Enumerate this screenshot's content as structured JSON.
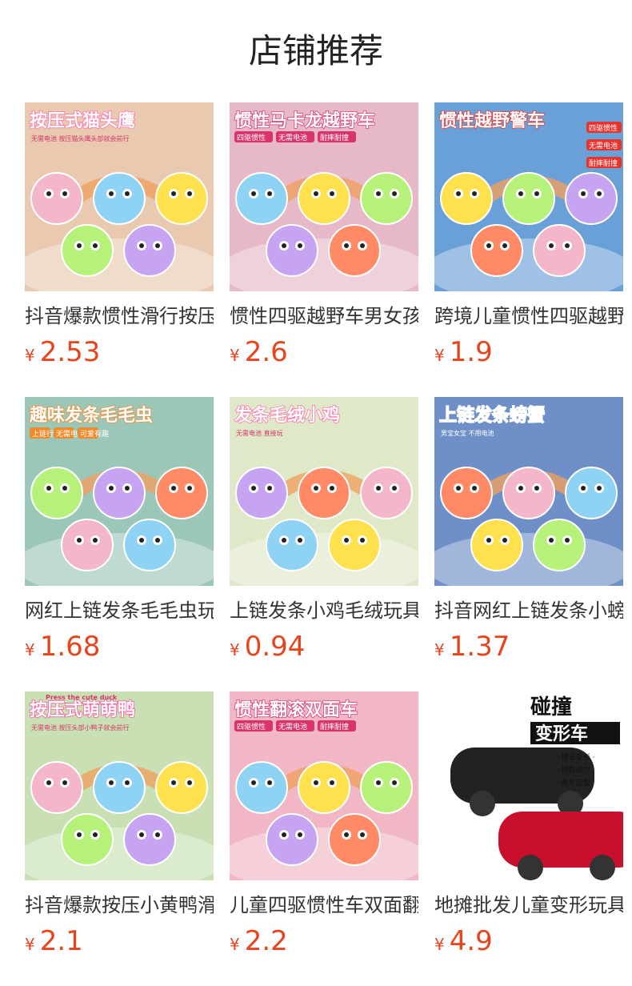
{
  "section_title": "店铺推荐",
  "products": [
    {
      "name": "抖音爆款惯性滑行按压式猫头鹰",
      "currency": "¥",
      "price": "2.53",
      "banner": "按压式猫头鹰",
      "sub": "无需电池 按压猫头鹰头部就会前行",
      "icon": "owl-toy-image",
      "bg": "#e9c9b0",
      "accent": "#ff6fa5"
    },
    {
      "name": "惯性四驱越野车男女孩玩具",
      "currency": "¥",
      "price": "2.6",
      "banner": "惯性马卡龙越野车",
      "tags": [
        "四驱惯性",
        "无需电池",
        "耐摔耐撞"
      ],
      "icon": "offroad-car-toy-image",
      "bg": "#e6b8c8",
      "accent": "#d9336b"
    },
    {
      "name": "跨境儿童惯性四驱越野警车",
      "currency": "¥",
      "price": "1.9",
      "banner": "惯性越野警车",
      "tags": [
        "四驱惯性",
        "无需电池",
        "耐摔耐撞"
      ],
      "icon": "police-car-toy-image",
      "bg": "#6aa0d8",
      "accent": "#e7332b"
    },
    {
      "name": "网红上链发条毛毛虫玩具",
      "currency": "¥",
      "price": "1.68",
      "banner": "趣味发条毛毛虫",
      "tags": [
        "上链行走",
        "无需电池",
        "可爱有趣"
      ],
      "icon": "caterpillar-toy-image",
      "bg": "#9bc7b9",
      "accent": "#f08a2b"
    },
    {
      "name": "上链发条小鸡毛绒玩具",
      "currency": "¥",
      "price": "0.94",
      "banner": "发条毛绒小鸡",
      "sub": "无需电池 直接玩",
      "icon": "chick-toy-image",
      "bg": "#dfe9c8",
      "accent": "#ff6fa5"
    },
    {
      "name": "抖音网红上链发条小螃蟹",
      "currency": "¥",
      "price": "1.37",
      "banner": "上链发条螃蟹",
      "sub": "男宝女宝 不用电池",
      "icon": "crab-toy-image",
      "bg": "#6e8fc8",
      "accent": "#ffffff"
    },
    {
      "name": "抖音爆款按压小黄鸭滑行车",
      "currency": "¥",
      "price": "2.1",
      "banner": "按压式萌萌鸭",
      "sub": "无需电池 按压头部小鸭子就会前行",
      "top": "Press the cute duck",
      "icon": "duck-toy-image",
      "bg": "#c8e0b4",
      "accent": "#ff4f9a"
    },
    {
      "name": "儿童四驱惯性车双面翻滚车",
      "currency": "¥",
      "price": "2.2",
      "banner": "惯性翻滚双面车",
      "tags": [
        "四驱惯性",
        "无需电池",
        "耐摔耐撞"
      ],
      "icon": "flip-car-toy-image",
      "bg": "#f1b7c5",
      "accent": "#d9336b"
    },
    {
      "name": "地摊批发儿童变形玩具车",
      "currency": "¥",
      "price": "4.9",
      "banner": "碰撞",
      "banner2": "变形车",
      "tags": [
        "撞击变形",
        "惯性动力",
        "跑车造型"
      ],
      "icon": "transform-car-toy-image",
      "bg": "#ffffff",
      "accent": "#111111"
    }
  ]
}
